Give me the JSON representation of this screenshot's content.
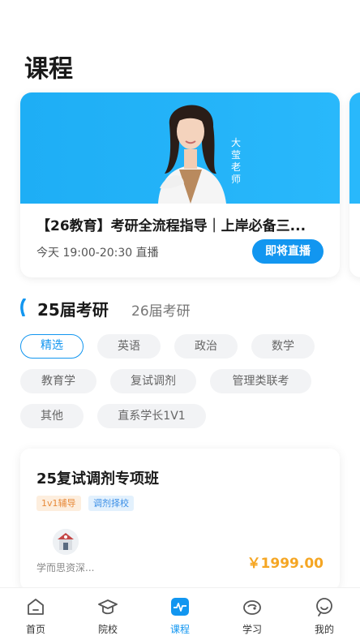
{
  "page": {
    "title": "课程"
  },
  "live_card": {
    "teacher_tag": "大\n莹\n老\n师",
    "title": "【26教育】考研全流程指导｜上岸必备三...",
    "time": "今天 19:00-20:30 直播",
    "button": "即将直播"
  },
  "year_tabs": {
    "active": "25届考研",
    "other": "26届考研"
  },
  "categories": [
    "精选",
    "英语",
    "政治",
    "数学",
    "教育学",
    "复试调剂",
    "管理类联考",
    "其他",
    "直系学长1V1"
  ],
  "course": {
    "title": "25复试调剂专项班",
    "tags": [
      "1v1辅导",
      "调剂择校"
    ],
    "school": "学而思资深...",
    "price": "￥1999.00"
  },
  "tabbar": {
    "items": [
      {
        "label": "首页",
        "icon": "home-icon"
      },
      {
        "label": "院校",
        "icon": "graduation-cap-icon"
      },
      {
        "label": "课程",
        "icon": "course-pulse-icon",
        "active": true
      },
      {
        "label": "学习",
        "icon": "study-icon"
      },
      {
        "label": "我的",
        "icon": "profile-icon"
      }
    ]
  },
  "colors": {
    "accent": "#1296f0",
    "banner": "#29b8fb",
    "price": "#f5a623"
  }
}
